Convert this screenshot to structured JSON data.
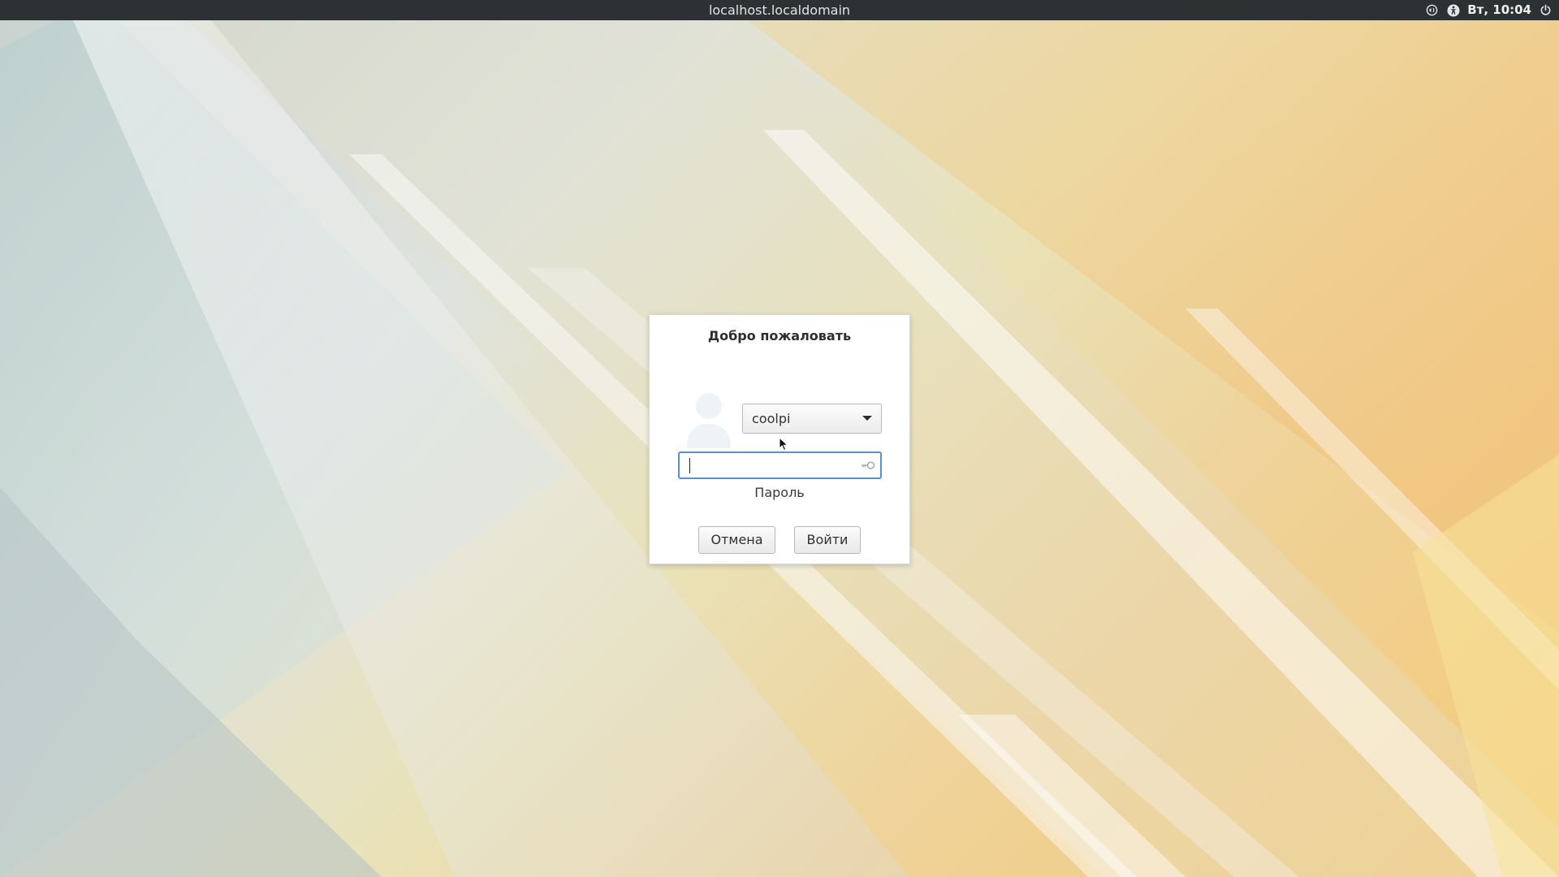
{
  "topbar": {
    "hostname": "localhost.localdomain",
    "clock": "Вт, 10:04",
    "icons": [
      "screen-reader-icon",
      "accessibility-icon",
      "power-icon"
    ]
  },
  "dialog": {
    "title": "Добро пожаловать",
    "user_select": {
      "selected": "coolpi"
    },
    "password": {
      "value": "",
      "placeholder": "",
      "label": "Пароль"
    },
    "buttons": {
      "cancel": "Отмена",
      "login": "Войти"
    }
  },
  "colors": {
    "topbar_bg": "#2e3134",
    "focus_border": "#5b8ed6",
    "dialog_bg": "#ffffff"
  }
}
